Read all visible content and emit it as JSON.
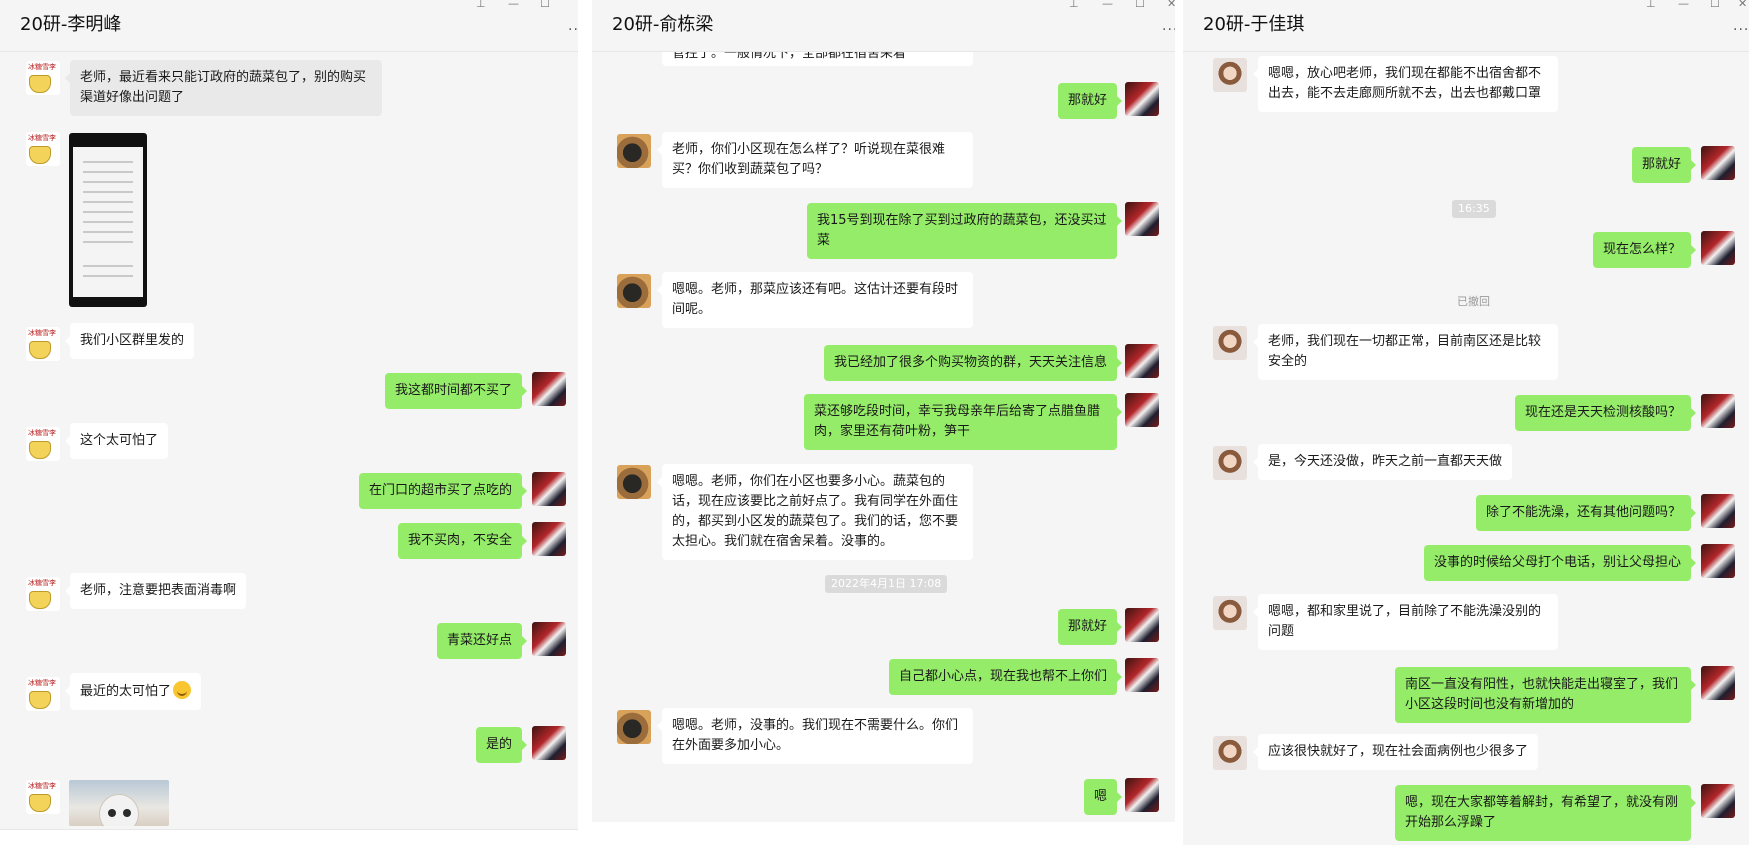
{
  "window_controls": {
    "pin": "⊥",
    "minimize": "—",
    "maximize": "☐",
    "close": "✕",
    "more": "..."
  },
  "panel1": {
    "title": "20研-李明峰",
    "avatar_text": "冰糖雪李",
    "messages": [
      "老师，最近看来只能订政府的蔬菜包了，别的购买渠道好像出问题了",
      "我们小区群里发的",
      "我这都时间都不买了",
      "这个太可怕了",
      "在门口的超市买了点吃的",
      "我不买肉，不安全",
      "老师，注意要把表面消毒啊",
      "青菜还好点",
      "最近的太可怕了",
      "是的"
    ]
  },
  "panel2": {
    "title": "20研-俞栋梁",
    "messages": [
      "管控了。一般情况下，全部都在宿舍呆着",
      "那就好",
      "老师，你们小区现在怎么样了？听说现在菜很难买？你们收到蔬菜包了吗？",
      "我15号到现在除了买到过政府的蔬菜包，还没买过菜",
      "嗯嗯。老师，那菜应该还有吧。这估计还要有段时间呢。",
      "我已经加了很多个购买物资的群，天天关注信息",
      "菜还够吃段时间，幸亏我母亲年后给寄了点腊鱼腊肉，家里还有荷叶粉，笋干",
      "嗯嗯。老师，你们在小区也要多小心。蔬菜包的话，现在应该要比之前好点了。我有同学在外面住的，都买到小区发的蔬菜包了。我们的话，您不要太担心。我们就在宿舍呆着。没事的。",
      "那就好",
      "自己都小心点，现在我也帮不上你们",
      "嗯嗯。老师，没事的。我们现在不需要什么。你们在外面要多加小心。",
      "嗯"
    ],
    "timestamp": "2022年4月1日 17:08"
  },
  "panel3": {
    "title": "20研-于佳琪",
    "messages": [
      "嗯嗯，放心吧老师，我们现在都能不出宿舍都不出去，能不去走廊厕所就不去，出去也都戴口罩",
      "那就好",
      "现在怎么样？",
      "老师，我们现在一切都正常，目前南区还是比较安全的",
      "现在还是天天检测核酸吗？",
      "是，今天还没做，昨天之前一直都天天做",
      "除了不能洗澡，还有其他问题吗？",
      "没事的时候给父母打个电话，别让父母担心",
      "嗯嗯，都和家里说了，目前除了不能洗澡没别的问题",
      "南区一直没有阳性，也就快能走出寝室了，我们小区这段时间也没有新增加的",
      "应该很快就好了，现在社会面病例也少很多了",
      "嗯，现在大家都等着解封，有希望了，就没有刚开始那么浮躁了"
    ],
    "timestamp": "16:35",
    "recalled": "已撤回"
  }
}
